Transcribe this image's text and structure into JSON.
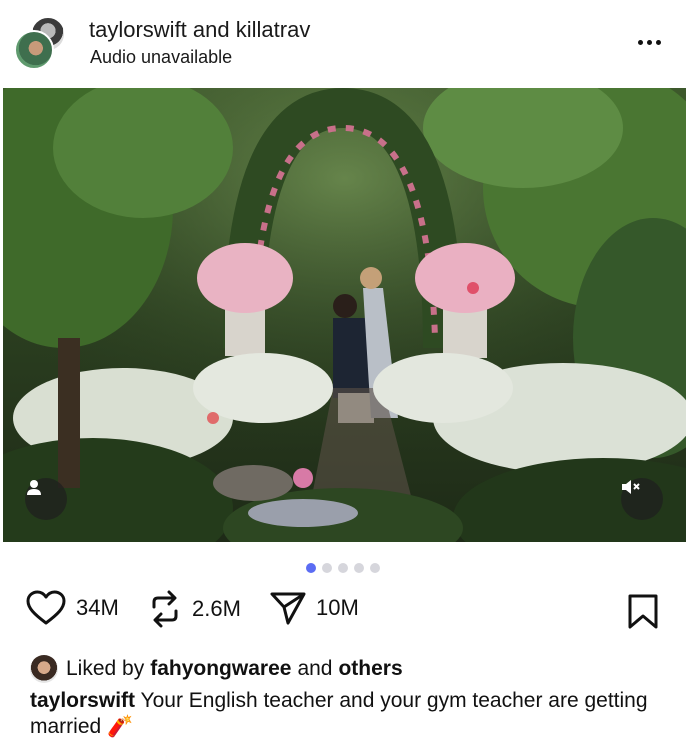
{
  "header": {
    "user1": "taylorswift",
    "connector": "and",
    "user2": "killatrav",
    "subtitle": "Audio unavailable",
    "more_icon": "more-horizontal-icon"
  },
  "media": {
    "description_icon": "photo",
    "user_tag_icon": "person-icon",
    "mute_icon": "speaker-muted-icon"
  },
  "carousel": {
    "total": 5,
    "active_index": 0
  },
  "actions": {
    "likes": "34M",
    "reposts": "2.6M",
    "shares": "10M"
  },
  "likes_line": {
    "prefix": "Liked by",
    "user": "fahyongwaree",
    "middle": "and",
    "suffix": "others"
  },
  "caption": {
    "user": "taylorswift",
    "text": "Your English teacher and your gym teacher are getting married",
    "emoji": "🧨"
  },
  "colors": {
    "accent_dot": "#5b6cf3",
    "inactive_dot": "#d6d6dc"
  }
}
